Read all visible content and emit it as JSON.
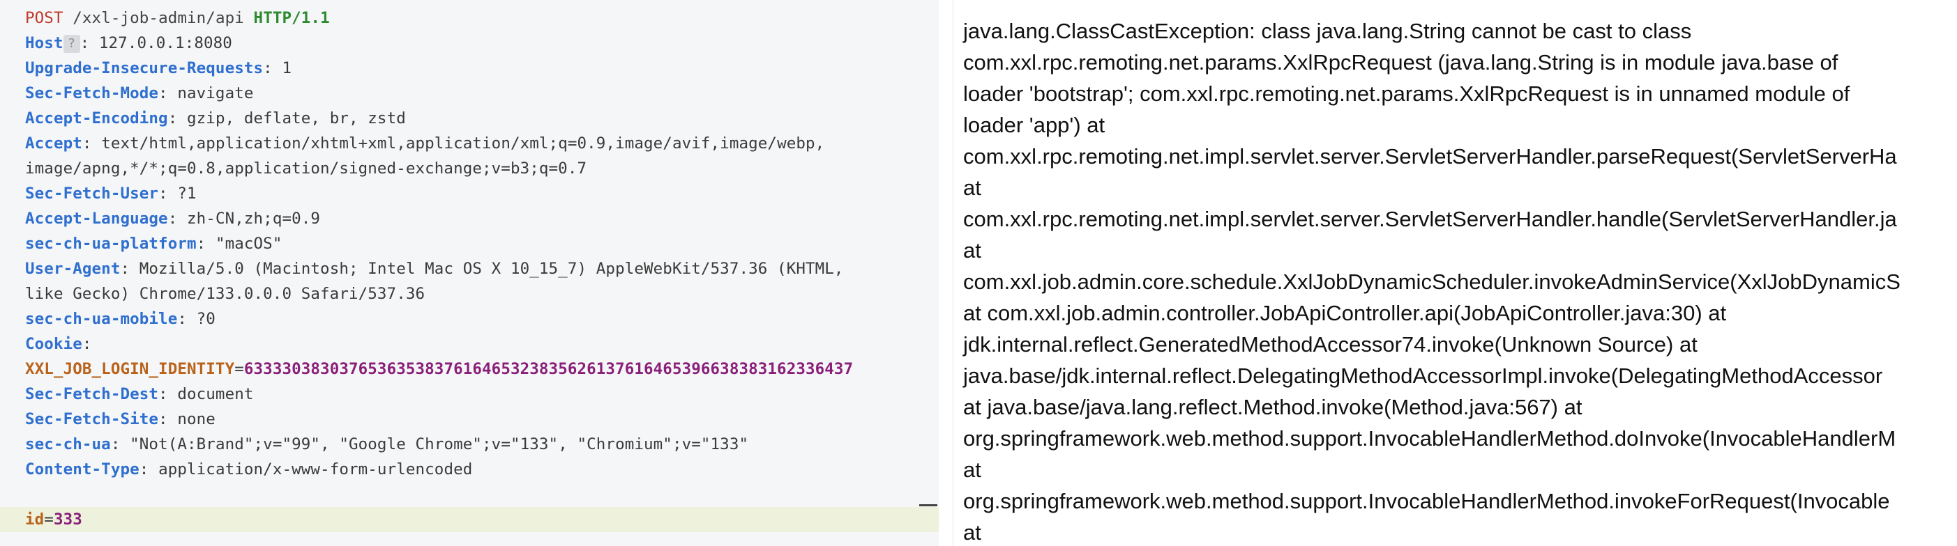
{
  "request": {
    "request_line": {
      "method": "POST",
      "path": "/xxl-job-admin/api",
      "protocol": "HTTP/1.1"
    },
    "headers": [
      {
        "id": "host",
        "name": "Host",
        "value": "127.0.0.1:8080"
      },
      {
        "id": "upgrade-insecure-requests",
        "name": "Upgrade-Insecure-Requests",
        "value": "1"
      },
      {
        "id": "sec-fetch-mode",
        "name": "Sec-Fetch-Mode",
        "value": "navigate"
      },
      {
        "id": "accept-encoding",
        "name": "Accept-Encoding",
        "value": "gzip, deflate, br, zstd"
      },
      {
        "id": "accept",
        "name": "Accept",
        "value": "text/html,application/xhtml+xml,application/xml;q=0.9,image/avif,image/webp,",
        "continuation": "image/apng,*/*;q=0.8,application/signed-exchange;v=b3;q=0.7"
      },
      {
        "id": "sec-fetch-user",
        "name": "Sec-Fetch-User",
        "value": "?1"
      },
      {
        "id": "accept-language",
        "name": "Accept-Language",
        "value": "zh-CN,zh;q=0.9"
      },
      {
        "id": "sec-ch-ua-platform",
        "name": "sec-ch-ua-platform",
        "value": "\"macOS\""
      },
      {
        "id": "user-agent",
        "name": "User-Agent",
        "value": "Mozilla/5.0 (Macintosh; Intel Mac OS X 10_15_7) AppleWebKit/537.36 (KHTML,",
        "continuation": "like Gecko) Chrome/133.0.0.0 Safari/537.36"
      },
      {
        "id": "sec-ch-ua-mobile",
        "name": "sec-ch-ua-mobile",
        "value": "?0"
      },
      {
        "id": "cookie",
        "name": "Cookie",
        "value": ""
      },
      {
        "id": "sec-fetch-dest",
        "name": "Sec-Fetch-Dest",
        "value": "document"
      },
      {
        "id": "sec-fetch-site",
        "name": "Sec-Fetch-Site",
        "value": "none"
      },
      {
        "id": "sec-ch-ua",
        "name": "sec-ch-ua",
        "value": "\"Not(A:Brand\";v=\"99\", \"Google Chrome\";v=\"133\", \"Chromium\";v=\"133\""
      },
      {
        "id": "content-type",
        "name": "Content-Type",
        "value": "application/x-www-form-urlencoded"
      }
    ],
    "cookie": {
      "name": "XXL_JOB_LOGIN_IDENTITY",
      "value": "6333303830376536353837616465323835626137616465396638383162336437"
    },
    "body": {
      "key": "id",
      "value": "333"
    }
  },
  "response": {
    "lines": [
      "java.lang.ClassCastException: class java.lang.String cannot be cast to class",
      "com.xxl.rpc.remoting.net.params.XxlRpcRequest (java.lang.String is in module java.base of",
      "loader 'bootstrap'; com.xxl.rpc.remoting.net.params.XxlRpcRequest is in unnamed module of",
      "loader 'app') at",
      "com.xxl.rpc.remoting.net.impl.servlet.server.ServletServerHandler.parseRequest(ServletServerHa",
      "at",
      "com.xxl.rpc.remoting.net.impl.servlet.server.ServletServerHandler.handle(ServletServerHandler.ja",
      "at",
      "com.xxl.job.admin.core.schedule.XxlJobDynamicScheduler.invokeAdminService(XxlJobDynamicS",
      "at com.xxl.job.admin.controller.JobApiController.api(JobApiController.java:30) at",
      "jdk.internal.reflect.GeneratedMethodAccessor74.invoke(Unknown Source) at",
      "java.base/jdk.internal.reflect.DelegatingMethodAccessorImpl.invoke(DelegatingMethodAccessor",
      "at java.base/java.lang.reflect.Method.invoke(Method.java:567) at",
      "org.springframework.web.method.support.InvocableHandlerMethod.doInvoke(InvocableHandlerM",
      "at",
      "org.springframework.web.method.support.InvocableHandlerMethod.invokeForRequest(Invocable",
      "at"
    ]
  },
  "colors": {
    "method": "#c0392b",
    "protocol": "#2d8a2d",
    "header_name": "#2f6fcf",
    "cookie_name": "#b9621a",
    "cookie_value": "#8a1f7a",
    "request_bg": "#f5f6f7",
    "body_line_bg": "#eef2dd"
  },
  "icons": {
    "host_hint": "question-mark-icon"
  }
}
